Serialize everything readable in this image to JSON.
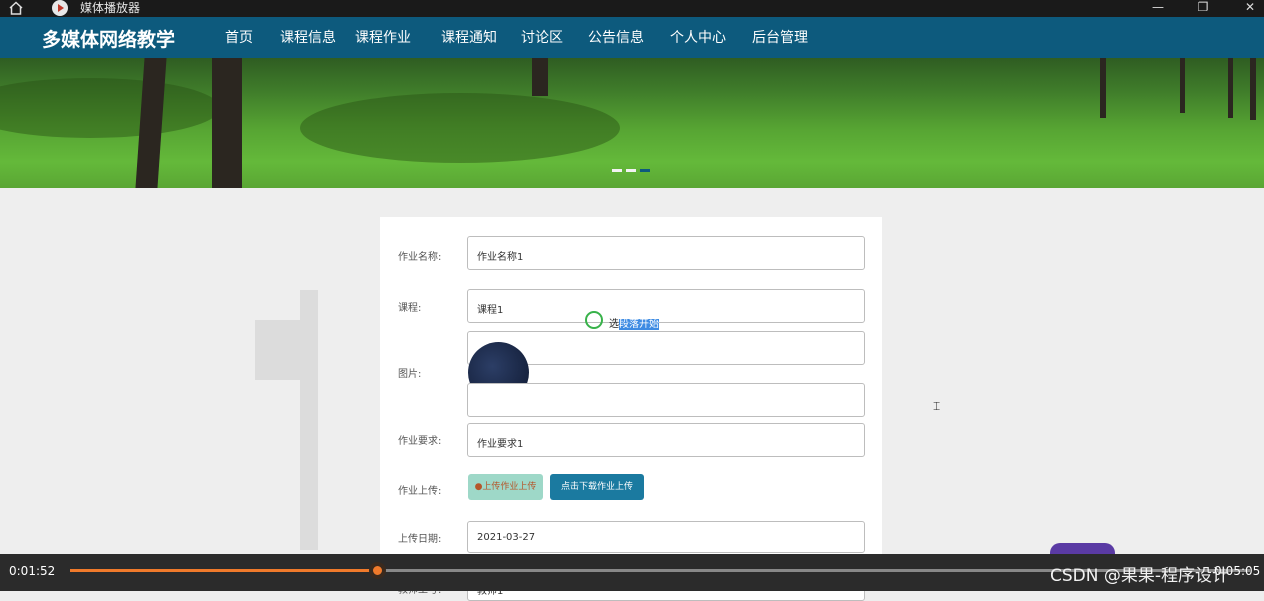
{
  "player": {
    "app_title": "媒体播放器",
    "current_time": "0:01:52",
    "total_time": "0:05:05",
    "progress": 0.26
  },
  "site": {
    "title": "多媒体网络教学",
    "nav": [
      "首页",
      "课程信息",
      "课程作业",
      "课程通知",
      "讨论区",
      "公告信息",
      "个人中心",
      "后台管理"
    ],
    "active_index": 2
  },
  "form": {
    "name_label": "作业名称:",
    "name_value": "作业名称1",
    "course_label": "课程:",
    "course_value": "课程1",
    "image_label": "图片:",
    "req_label": "作业要求:",
    "req_value": "作业要求1",
    "upload_label": "作业上传:",
    "upload_button": "上传作业上传",
    "download_button": "点击下载作业上传",
    "date_label": "上传日期:",
    "date_value": "2021-03-27",
    "teacher_label": "教师工号:",
    "teacher_value": "教师1"
  },
  "overlay": {
    "prefix": "选",
    "highlight": "段落开始"
  },
  "watermark": "CSDN @果果-程序设计",
  "colors": {
    "nav_bg": "#0d5a7d",
    "progress": "#f07a2b",
    "download_btn": "#1b7aa0",
    "upload_btn": "#9ed8c8"
  }
}
